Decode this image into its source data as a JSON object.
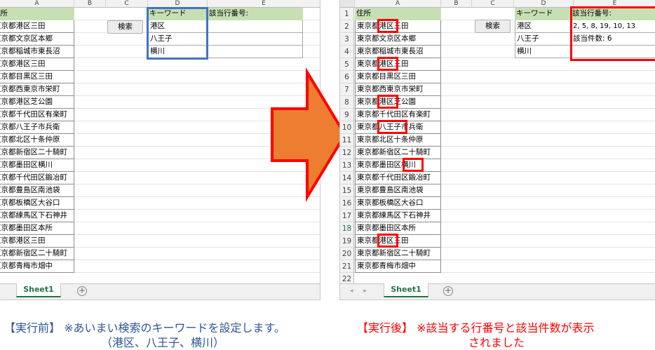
{
  "column_headers_left": [
    "A",
    "B",
    "C",
    "D",
    "E"
  ],
  "column_headers_right": [
    "A",
    "B",
    "C",
    "D",
    "E"
  ],
  "address_header": "住所",
  "addresses": [
    "東京都港区三田",
    "東京都文京区本郷",
    "東京都稲城市東長沼",
    "東京都港区三田",
    "東京都目黒区三田",
    "東京都西東京市栄町",
    "東京都港区芝公園",
    "東京都千代田区有楽町",
    "東京都八王子市兵衛",
    "東京都北区十条仲原",
    "東京都新宿区二十騎町",
    "東京都墨田区横川",
    "東京都千代田区鍛冶町",
    "東京都豊島区南池袋",
    "東京都板橋区大谷口",
    "東京都練馬区下石神井",
    "東京都墨田区本所",
    "東京都港区三田",
    "東京都新宿区二十騎町",
    "東京都青梅市畑中"
  ],
  "row_numbers": [
    "1",
    "2",
    "3",
    "4",
    "5",
    "6",
    "7",
    "8",
    "9",
    "10",
    "11",
    "12",
    "13",
    "14",
    "15",
    "16",
    "17",
    "18",
    "19",
    "20",
    "21",
    "22"
  ],
  "search_button_label": "検索",
  "keyword_header": "キーワード",
  "keywords": [
    "港区",
    "八王子",
    "横川"
  ],
  "result_header": "該当行番号:",
  "result_rows": "2, 5, 8, 19, 10, 13",
  "result_count": "該当件数: 6",
  "sheet_tab_label": "Sheet1",
  "add_sheet_symbol": "+",
  "nav_arrows": "◂ ▸",
  "caption_before_line1": "【実行前】 ※あいまい検索のキーワードを設定します。",
  "caption_before_line2": "（港区、八王子、横川）",
  "caption_after_line1": "【実行後】 ※該当する行番号と該当件数が表示",
  "caption_after_line2": "されました",
  "colors": {
    "header_green": "#c6e0b4",
    "highlight_blue": "#4472c4",
    "highlight_red": "#ff0000",
    "arrow_orange": "#ed7d31",
    "caption_before": "#2e5597",
    "caption_after": "#ff0000",
    "sheet_tab_green": "#217346"
  },
  "icons": [
    "arrow-right-icon",
    "add-sheet-icon"
  ]
}
